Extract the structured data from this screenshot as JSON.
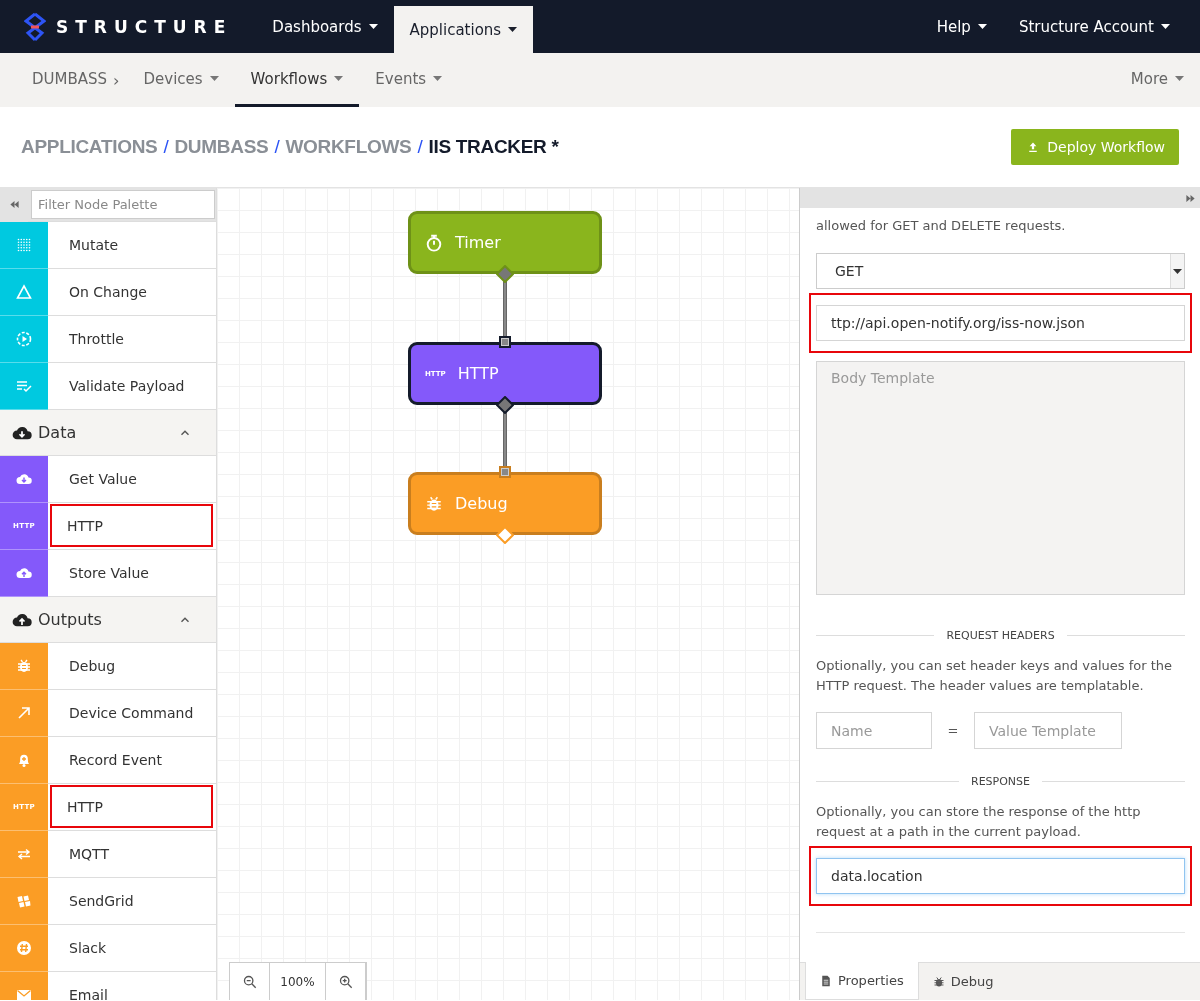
{
  "top_nav": {
    "logo": "STRUCTURE",
    "items": [
      {
        "label": "Dashboards",
        "selected": false
      },
      {
        "label": "Applications",
        "selected": true
      }
    ],
    "right_items": [
      "Help",
      "Structure Account"
    ]
  },
  "sub_nav": {
    "app": "DUMBASS",
    "separator": "›",
    "items": [
      {
        "label": "Devices",
        "selected": false
      },
      {
        "label": "Workflows",
        "selected": true
      },
      {
        "label": "Events",
        "selected": false
      }
    ],
    "more": "More"
  },
  "breadcrumb": {
    "separator": "/",
    "items": [
      {
        "label": "APPLICATIONS",
        "current": false
      },
      {
        "label": "DUMBASS",
        "current": false
      },
      {
        "label": "WORKFLOWS",
        "current": false
      },
      {
        "label": "IIS TRACKER *",
        "current": true
      }
    ]
  },
  "deploy_button": "Deploy Workflow",
  "palette": {
    "filter_placeholder": "Filter Node Palette",
    "groups": [
      {
        "color": "#00c9e0",
        "items": [
          {
            "label": "Mutate",
            "highlighted": false
          },
          {
            "label": "On Change",
            "highlighted": false
          },
          {
            "label": "Throttle",
            "highlighted": false
          },
          {
            "label": "Validate Payload",
            "highlighted": false
          }
        ]
      },
      {
        "title": "Data",
        "expanded": true,
        "color": "#8459fa",
        "items": [
          {
            "label": "Get Value",
            "highlighted": false
          },
          {
            "label": "HTTP",
            "badge": "HTTP",
            "highlighted": true
          },
          {
            "label": "Store Value",
            "highlighted": false
          }
        ]
      },
      {
        "title": "Outputs",
        "expanded": true,
        "color": "#fb9d25",
        "items": [
          {
            "label": "Debug",
            "highlighted": false
          },
          {
            "label": "Device Command",
            "highlighted": false
          },
          {
            "label": "Record Event",
            "highlighted": false
          },
          {
            "label": "HTTP",
            "badge": "HTTP",
            "highlighted": true
          },
          {
            "label": "MQTT",
            "highlighted": false
          },
          {
            "label": "SendGrid",
            "highlighted": false
          },
          {
            "label": "Slack",
            "highlighted": false
          },
          {
            "label": "Email",
            "highlighted": false
          }
        ]
      }
    ]
  },
  "canvas": {
    "nodes": [
      {
        "label": "Timer",
        "color": "#8ab51d",
        "selected": false
      },
      {
        "label": "HTTP",
        "badge": "HTTP",
        "color": "#8459fa",
        "selected": true
      },
      {
        "label": "Debug",
        "color": "#fb9d25",
        "selected": false
      }
    ],
    "zoom": "100%"
  },
  "properties": {
    "intro": "allowed for GET and DELETE requests.",
    "method_select": {
      "value": "GET"
    },
    "url_field": {
      "value": "ttp://api.open-notify.org/iss-now.json",
      "highlighted": true
    },
    "body_field": {
      "placeholder": "Body Template"
    },
    "headers_section": {
      "title": "REQUEST HEADERS",
      "text": "Optionally, you can set header keys and values for the HTTP request. The header values are templatable.",
      "name_placeholder": "Name",
      "equals": "=",
      "value_placeholder": "Value Template"
    },
    "response_section": {
      "title": "RESPONSE",
      "text": "Optionally, you can store the response of the http request at a path in the current payload.",
      "field": {
        "value": "data.location",
        "focused": true,
        "highlighted": true
      }
    },
    "tabs": [
      {
        "label": "Properties",
        "selected": true
      },
      {
        "label": "Debug",
        "selected": false
      }
    ]
  }
}
